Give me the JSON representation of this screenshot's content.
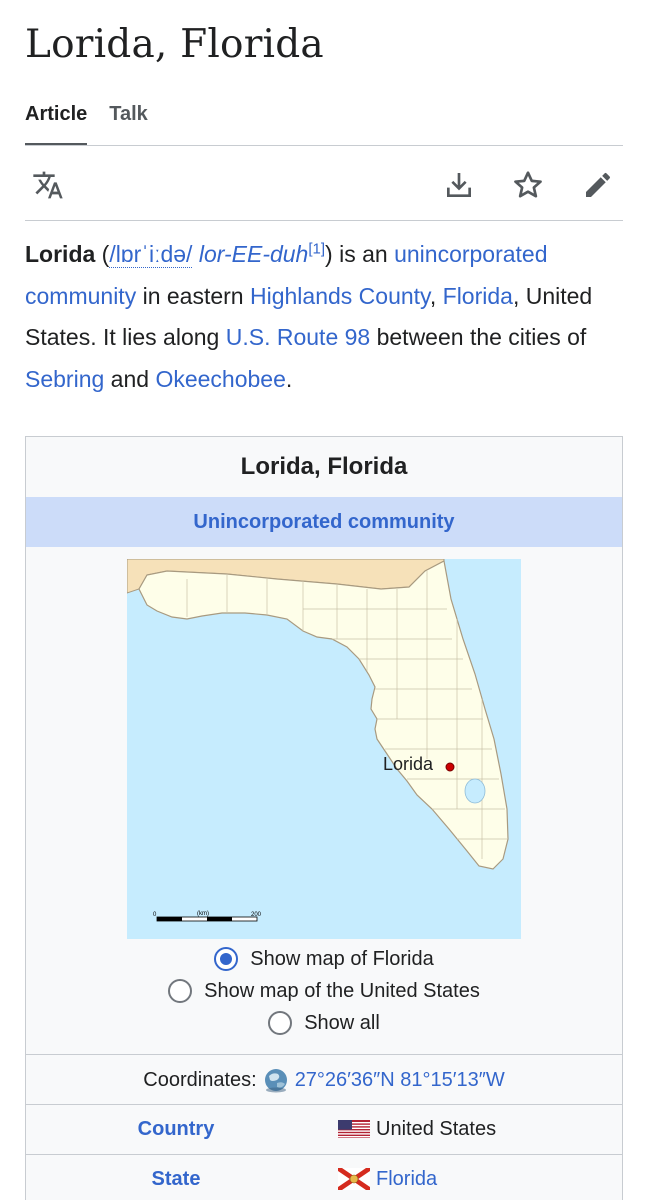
{
  "page": {
    "title": "Lorida, Florida"
  },
  "tabs": [
    {
      "label": "Article",
      "active": true
    },
    {
      "label": "Talk",
      "active": false
    }
  ],
  "toolbar": {
    "icons": [
      "language-icon",
      "download-icon",
      "star-icon",
      "edit-icon"
    ]
  },
  "intro": {
    "name": "Lorida",
    "paren_open": " (",
    "ipa": "/lɒrˈiːdə/",
    "respell": "lor-EE-duh",
    "cite": "[1]",
    "paren_close": ") is an ",
    "link_unincorporated": "unincorporated community",
    "text_in_eastern": " in eastern ",
    "link_county": "Highlands County",
    "comma": ", ",
    "link_state": "Florida",
    "text_us": ", United States. It lies along ",
    "link_route": "U.S. Route 98",
    "text_between": " between the cities of ",
    "link_sebring": "Sebring",
    "text_and": " and ",
    "link_okeechobee": "Okeechobee",
    "period": "."
  },
  "infobox": {
    "title": "Lorida, Florida",
    "subheader": "Unincorporated community",
    "map": {
      "marker_label": "Lorida",
      "scale_unit": "(km)",
      "scale_start": "0",
      "scale_end": "200",
      "colors": {
        "water": "#c6ecfe",
        "land": "#fefee9",
        "neighbor": "#f6e1b9",
        "marker": "#cc0000"
      }
    },
    "map_options": [
      {
        "label": "Show map of Florida",
        "checked": true
      },
      {
        "label": "Show map of the United States",
        "checked": false
      },
      {
        "label": "Show all",
        "checked": false
      }
    ],
    "coordinates": {
      "label": "Coordinates:",
      "value": "27°26′36″N 81°15′13″W"
    },
    "rows": [
      {
        "key": "Country",
        "value": "United States",
        "flag": "us-flag-icon"
      },
      {
        "key": "State",
        "value": "Florida",
        "flag": "florida-flag-icon",
        "value_is_link": true
      }
    ]
  }
}
